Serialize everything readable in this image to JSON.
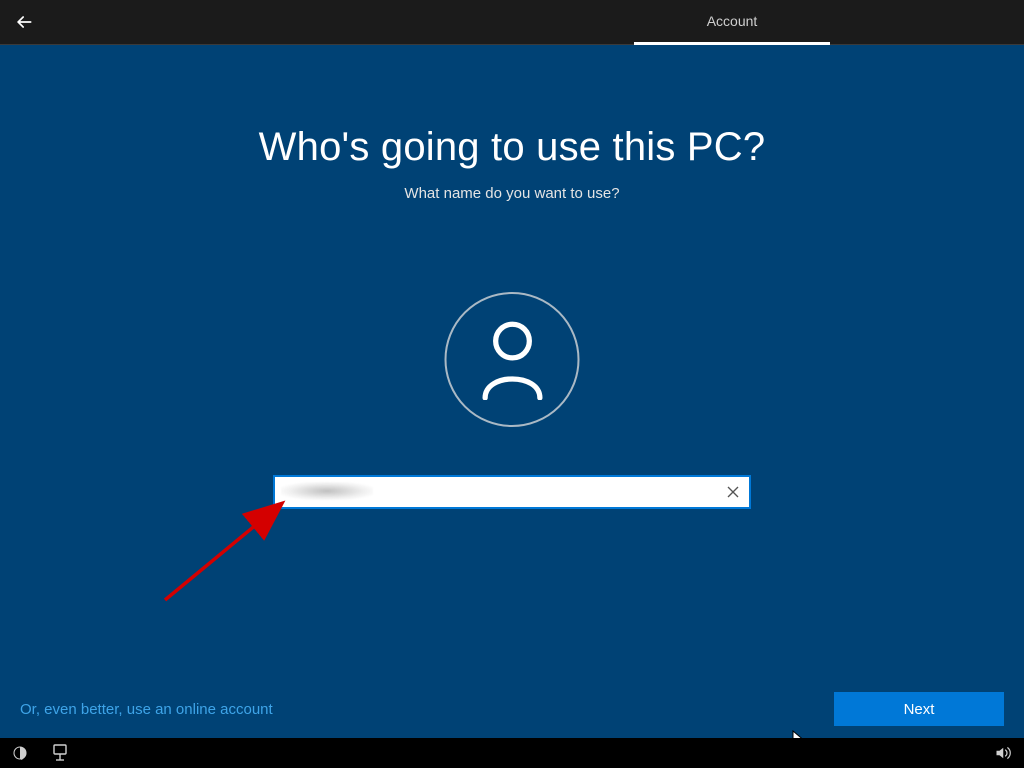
{
  "header": {
    "tab_label": "Account"
  },
  "main": {
    "title": "Who's going to use this PC?",
    "subtitle": "What name do you want to use?",
    "username_value": "",
    "username_placeholder": ""
  },
  "footer": {
    "online_account_link": "Or, even better, use an online account",
    "next_label": "Next"
  },
  "icons": {
    "back": "back-arrow-icon",
    "user": "person-icon",
    "clear": "clear-x-icon",
    "ease": "ease-of-access-icon",
    "ime": "ime-icon",
    "volume": "volume-icon"
  }
}
